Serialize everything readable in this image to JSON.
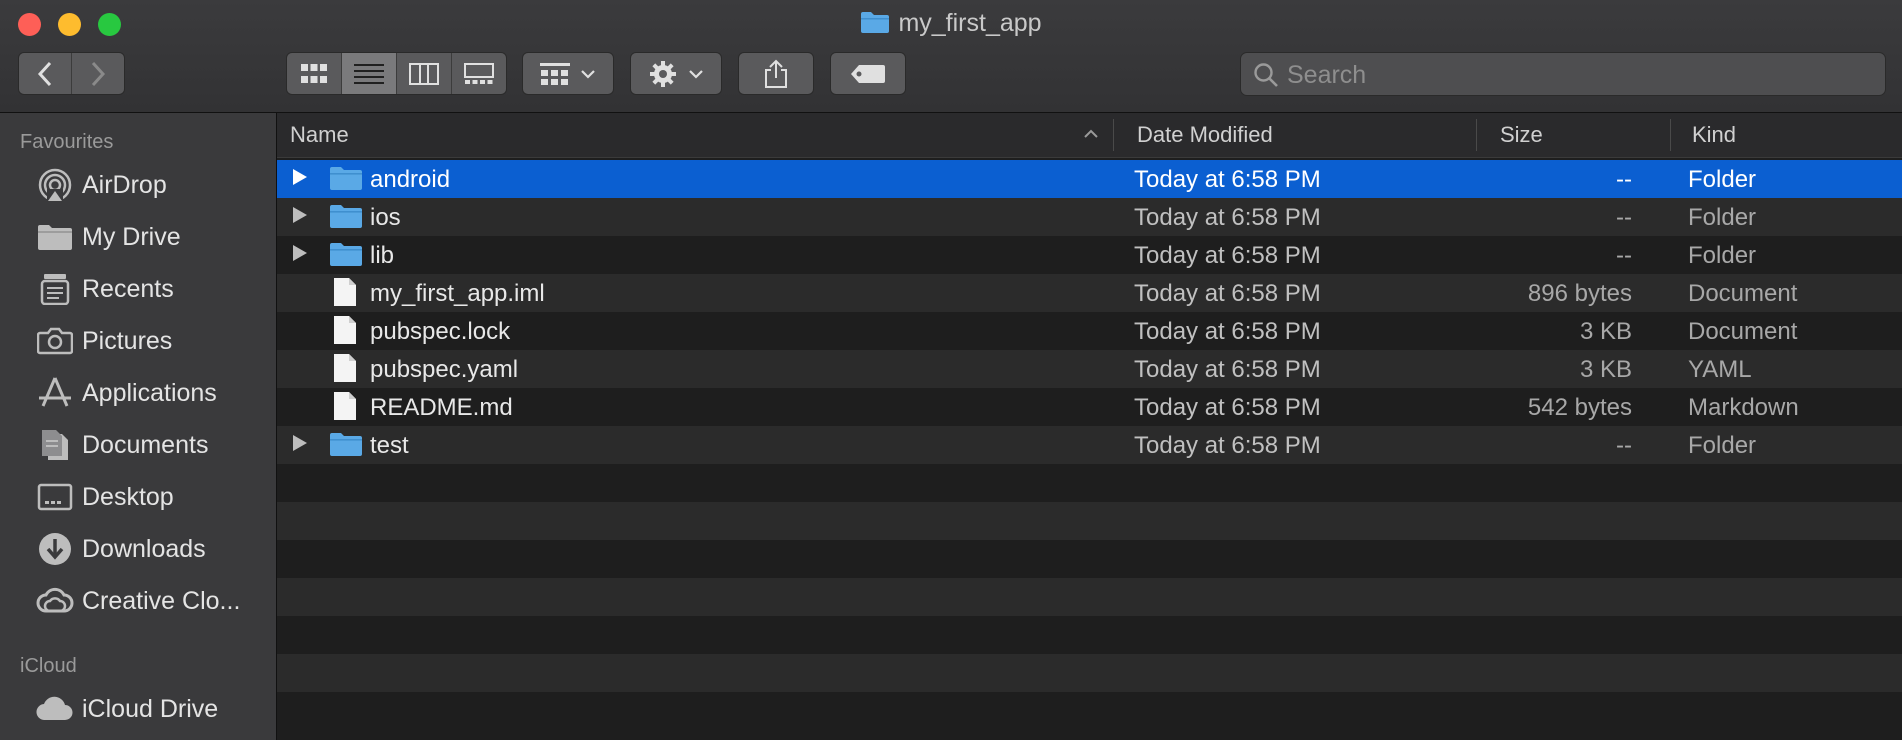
{
  "window": {
    "title": "my_first_app"
  },
  "toolbar": {
    "back_icon": "chevron-left-icon",
    "forward_icon": "chevron-right-icon",
    "views": [
      "icon-view",
      "list-view",
      "column-view",
      "gallery-view"
    ],
    "active_view": "list-view",
    "search_placeholder": "Search"
  },
  "sidebar": {
    "favourites_label": "Favourites",
    "items": [
      {
        "label": "AirDrop",
        "icon": "airdrop-icon"
      },
      {
        "label": "My Drive",
        "icon": "folder-icon"
      },
      {
        "label": "Recents",
        "icon": "recents-icon"
      },
      {
        "label": "Pictures",
        "icon": "camera-icon"
      },
      {
        "label": "Applications",
        "icon": "applications-icon"
      },
      {
        "label": "Documents",
        "icon": "document-icon"
      },
      {
        "label": "Desktop",
        "icon": "desktop-icon"
      },
      {
        "label": "Downloads",
        "icon": "download-icon"
      },
      {
        "label": "Creative Clo...",
        "icon": "creative-cloud-icon"
      }
    ],
    "icloud_label": "iCloud",
    "icloud_items": [
      {
        "label": "iCloud Drive",
        "icon": "cloud-icon"
      }
    ]
  },
  "columns": {
    "name": "Name",
    "date": "Date Modified",
    "size": "Size",
    "kind": "Kind"
  },
  "files": [
    {
      "name": "android",
      "date": "Today at 6:58 PM",
      "size": "--",
      "kind": "Folder",
      "type": "folder",
      "selected": true
    },
    {
      "name": "ios",
      "date": "Today at 6:58 PM",
      "size": "--",
      "kind": "Folder",
      "type": "folder"
    },
    {
      "name": "lib",
      "date": "Today at 6:58 PM",
      "size": "--",
      "kind": "Folder",
      "type": "folder"
    },
    {
      "name": "my_first_app.iml",
      "date": "Today at 6:58 PM",
      "size": "896 bytes",
      "kind": "Document",
      "type": "file"
    },
    {
      "name": "pubspec.lock",
      "date": "Today at 6:58 PM",
      "size": "3 KB",
      "kind": "Document",
      "type": "file"
    },
    {
      "name": "pubspec.yaml",
      "date": "Today at 6:58 PM",
      "size": "3 KB",
      "kind": "YAML",
      "type": "file"
    },
    {
      "name": "README.md",
      "date": "Today at 6:58 PM",
      "size": "542 bytes",
      "kind": "Markdown",
      "type": "file"
    },
    {
      "name": "test",
      "date": "Today at 6:58 PM",
      "size": "--",
      "kind": "Folder",
      "type": "folder"
    }
  ],
  "colors": {
    "selection": "#0b5fd1",
    "folder": "#5aa9e6",
    "close": "#fe5f57",
    "minimize": "#febc2e",
    "maximize": "#28c840"
  }
}
